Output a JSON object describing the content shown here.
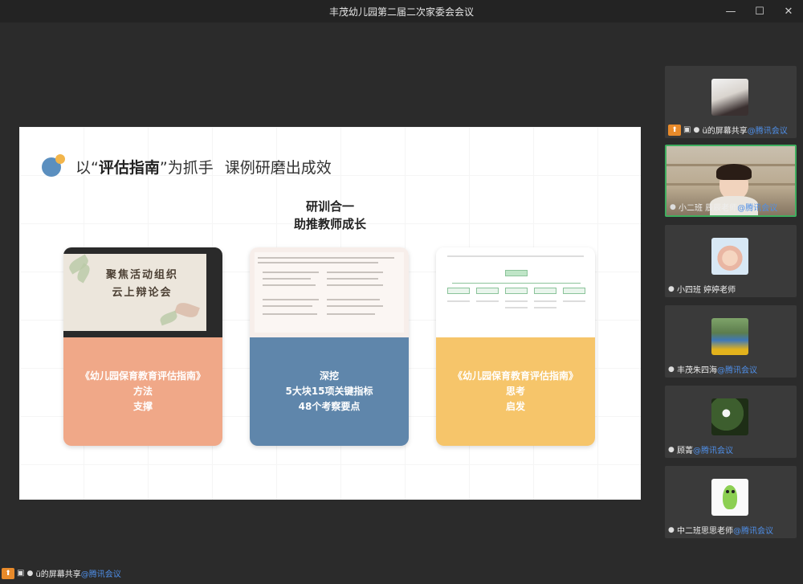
{
  "window": {
    "title": "丰茂幼儿园第二届二次家委会会议",
    "controls": [
      "minimize-icon",
      "maximize-icon",
      "close-icon"
    ]
  },
  "slide": {
    "heading_prefix": "以“",
    "heading_bold": "评估指南",
    "heading_mid": "”为抓手",
    "heading_suffix": "课例研磨出成效",
    "center_title_line1": "研训合一",
    "center_title_line2": "助推教师成长",
    "thumb1_title_line1": "聚焦活动组织",
    "thumb1_title_line2": "云上辩论会",
    "cards": [
      {
        "line1": "《幼儿园保育教育评估指南》",
        "line2": "方法",
        "line3": "支撑"
      },
      {
        "line1": "深挖",
        "line2": "5大块15项关键指标",
        "line3": "48个考察要点"
      },
      {
        "line1": "《幼儿园保育教育评估指南》",
        "line2": "思考",
        "line3": "启发"
      }
    ],
    "colors": {
      "card1": "#f0a888",
      "card2": "#5f86ab",
      "card3": "#f6c56a",
      "accent_dot": "#5b8fbf",
      "accent_dot_small": "#f2b54b"
    }
  },
  "participants": [
    {
      "name": "ü的屏幕共享",
      "tag": "@腾讯会议",
      "avatar": "portrait-avatar",
      "sharing": true
    },
    {
      "name": "小二班  辰辰老师",
      "tag": "@腾讯会议",
      "avatar": "camera-video",
      "active": true
    },
    {
      "name": "小四班  婷婷老师",
      "tag": "",
      "avatar": "portrait-avatar"
    },
    {
      "name": "丰茂朱四海",
      "tag": "@腾讯会议",
      "avatar": "portrait-avatar"
    },
    {
      "name": "顾菁",
      "tag": "@腾讯会议",
      "avatar": "plant-avatar"
    },
    {
      "name": "中二班思思老师",
      "tag": "@腾讯会议",
      "avatar": "cartoon-avatar"
    }
  ],
  "presenter_label": {
    "name": "ü的屏幕共享",
    "tag": "@腾讯会议"
  }
}
